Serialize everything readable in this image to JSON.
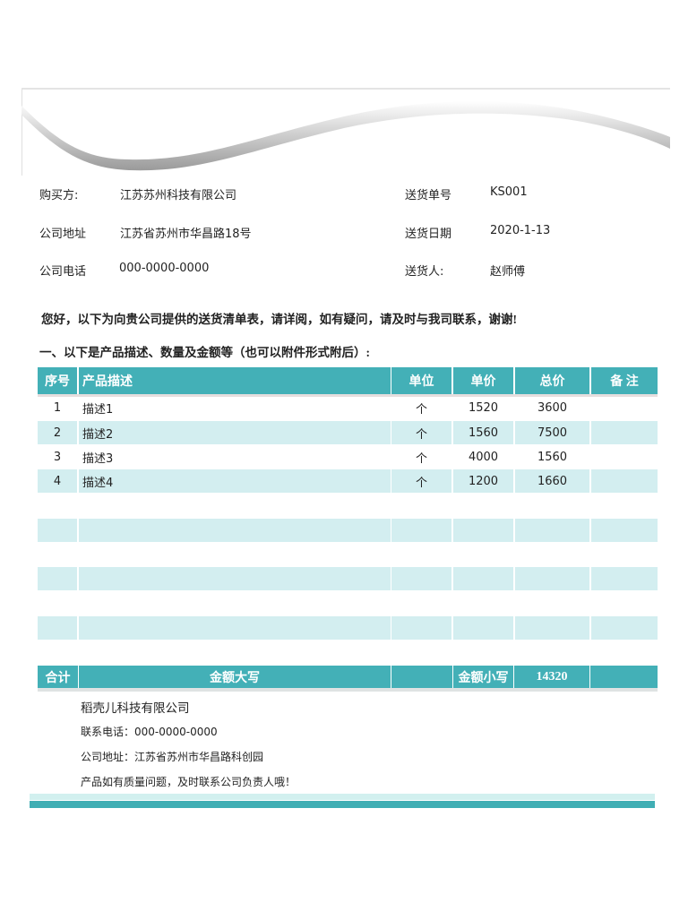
{
  "buyer": {
    "name_label": "购买方:",
    "name_value": "江苏苏州科技有限公司",
    "address_label": "公司地址",
    "address_value": "江苏省苏州市华昌路18号",
    "phone_label": "公司电话",
    "phone_value": "000-0000-0000"
  },
  "delivery": {
    "number_label": "送货单号",
    "number_value": "KS001",
    "date_label": "送货日期",
    "date_value": "2020-1-13",
    "person_label": "送货人:",
    "person_value": "赵师傅"
  },
  "greeting": "您好，以下为向贵公司提供的送货清单表，请详阅，如有疑问，请及时与我司联系，谢谢!",
  "section_title": "一、以下是产品描述、数量及金额等（也可以附件形式附后）:",
  "table": {
    "headers": [
      "序号",
      "产品描述",
      "单位",
      "单价",
      "总价",
      "备 注"
    ],
    "rows": [
      {
        "no": "1",
        "desc": "描述1",
        "unit": "个",
        "price": "1520",
        "total": "3600",
        "note": ""
      },
      {
        "no": "2",
        "desc": "描述2",
        "unit": "个",
        "price": "1560",
        "total": "7500",
        "note": ""
      },
      {
        "no": "3",
        "desc": "描述3",
        "unit": "个",
        "price": "4000",
        "total": "1560",
        "note": ""
      },
      {
        "no": "4",
        "desc": "描述4",
        "unit": "个",
        "price": "1200",
        "total": "1660",
        "note": ""
      }
    ],
    "total_row": {
      "label": "合计",
      "amount_words_label": "金额大写",
      "amount_words_value": "",
      "amount_figures_label": "金额小写",
      "amount_figures_value": "14320",
      "note": ""
    }
  },
  "footer": {
    "company": "稻壳儿科技有限公司",
    "phone": "联系电话：000-0000-0000",
    "address": "公司地址：江苏省苏州市华昌路科创园",
    "notice": "产品如有质量问题，及时联系公司负责人哦！"
  },
  "colors": {
    "header_teal": "#43b0b7",
    "row_alt": "#d3eef0",
    "bar_light": "#d2f0ef",
    "bar_dark": "#40aeb4"
  }
}
